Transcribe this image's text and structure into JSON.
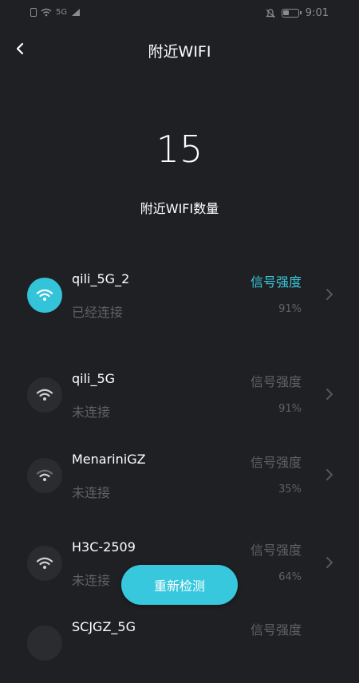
{
  "status_bar": {
    "network_label": "5G",
    "time": "9:01"
  },
  "header": {
    "title": "附近WIFI"
  },
  "summary": {
    "count": "15",
    "label": "附近WIFI数量"
  },
  "networks": [
    {
      "ssid": "qili_5G_2",
      "status": "已经连接",
      "signal_label": "信号强度",
      "signal_pct": "91%",
      "connected": true
    },
    {
      "ssid": "qili_5G",
      "status": "未连接",
      "signal_label": "信号强度",
      "signal_pct": "91%",
      "connected": false
    },
    {
      "ssid": "MenariniGZ",
      "status": "未连接",
      "signal_label": "信号强度",
      "signal_pct": "35%",
      "connected": false
    },
    {
      "ssid": "H3C-2509",
      "status": "未连接",
      "signal_label": "信号强度",
      "signal_pct": "64%",
      "connected": false
    },
    {
      "ssid": "SCJGZ_5G",
      "status": "",
      "signal_label": "信号强度",
      "signal_pct": "",
      "connected": false
    }
  ],
  "actions": {
    "detect_label": "重新检测"
  },
  "colors": {
    "background": "#1f2023",
    "accent": "#38c8de",
    "muted_text": "#5f6166"
  },
  "icons": {
    "back": "chevron-left-icon",
    "wifi": "wifi-icon",
    "row_arrow": "chevron-right-icon"
  }
}
